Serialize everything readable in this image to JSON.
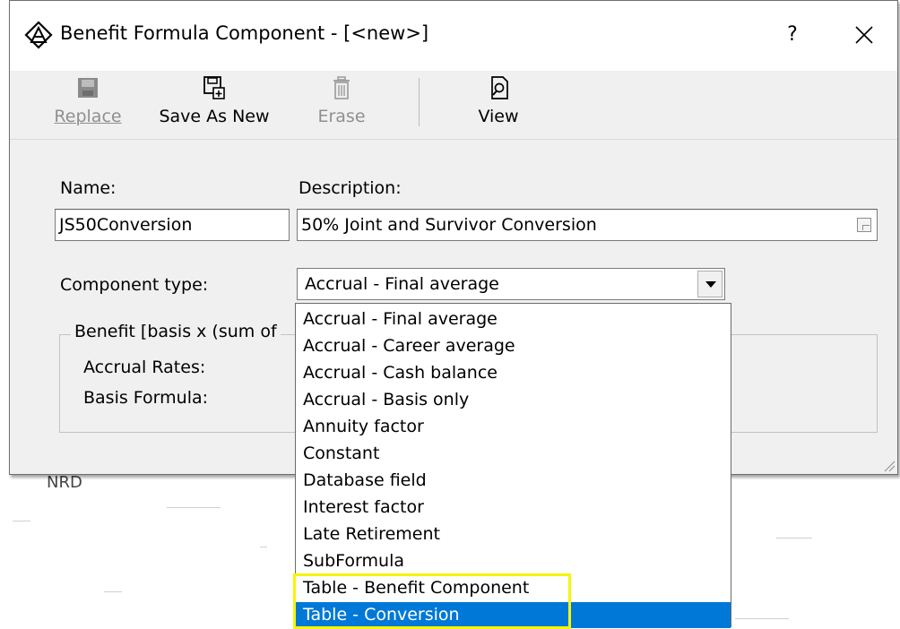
{
  "window": {
    "title": "Benefit Formula Component - [<new>]",
    "help": "?",
    "close": "✕"
  },
  "toolbar": {
    "replace": "Replace",
    "save_as_new": "Save As New",
    "erase": "Erase",
    "view": "View"
  },
  "form": {
    "name_label": "Name:",
    "name_value": "JS50Conversion",
    "description_label": "Description:",
    "description_value": "50% Joint and Survivor Conversion",
    "component_type_label": "Component type:",
    "component_type_value": "Accrual - Final average"
  },
  "group": {
    "title": "Benefit  [basis x (sum of",
    "accrual_rates_label": "Accrual Rates:",
    "basis_formula_label": "Basis Formula:"
  },
  "dropdown": {
    "options": [
      "Accrual - Final average",
      "Accrual - Career average",
      "Accrual - Cash balance",
      "Accrual - Basis only",
      "Annuity factor",
      "Constant",
      "Database field",
      "Interest factor",
      "Late Retirement",
      "SubFormula",
      "Table - Benefit Component",
      "Table - Conversion"
    ],
    "selected": "Table - Conversion",
    "highlight_color": "#f5f50a",
    "selection_color": "#0078d7"
  },
  "background": {
    "nrd_text": "NRD"
  }
}
